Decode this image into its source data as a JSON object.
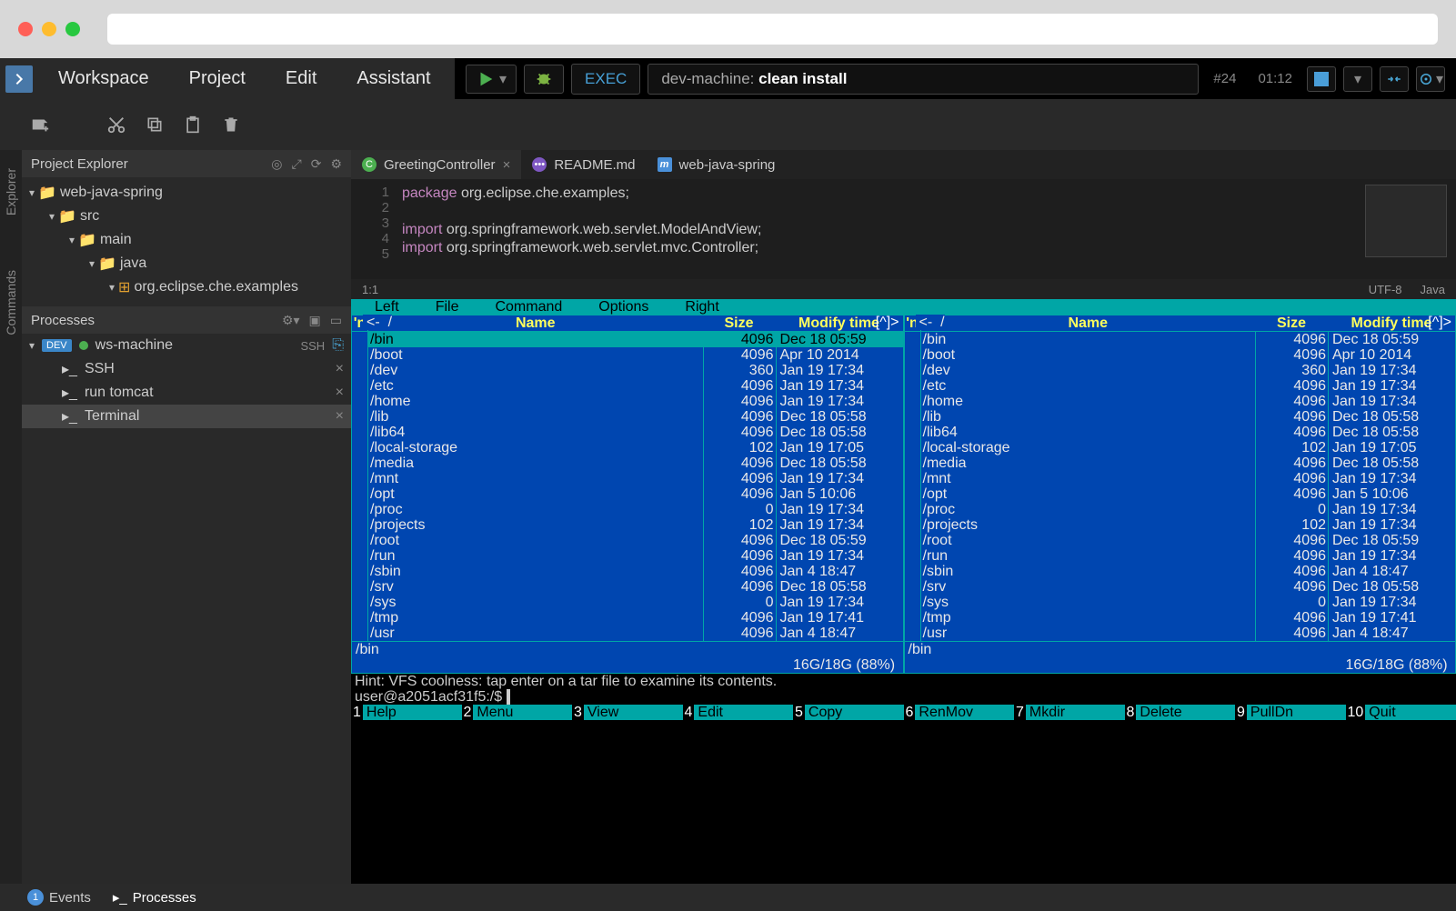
{
  "menu": {
    "workspace": "Workspace",
    "project": "Project",
    "edit": "Edit",
    "assistant": "Assistant"
  },
  "exec": {
    "label": "EXEC",
    "prefix": "dev-machine: ",
    "cmd": "clean install",
    "run_no": "#24",
    "time": "01:12"
  },
  "explorer": {
    "title": "Project Explorer",
    "nodes": {
      "root": "web-java-spring",
      "src": "src",
      "main": "main",
      "java": "java",
      "pkg": "org.eclipse.che.examples"
    }
  },
  "processes": {
    "title": "Processes",
    "machine": "ws-machine",
    "badge": "DEV",
    "ssh_abbr": "SSH",
    "items": [
      "SSH",
      "run tomcat",
      "Terminal"
    ]
  },
  "tabs": [
    {
      "icon": "green",
      "icon_text": "C",
      "label": "GreetingController",
      "closable": true,
      "active": true
    },
    {
      "icon": "purple",
      "icon_text": "•••",
      "label": "README.md",
      "closable": false,
      "active": false
    },
    {
      "icon": "blue",
      "icon_text": "m",
      "label": "web-java-spring",
      "closable": false,
      "active": false
    }
  ],
  "code": {
    "lines": [
      {
        "n": 1,
        "html": "<span class='kw'>package</span> org.eclipse.che.examples;"
      },
      {
        "n": 2,
        "html": ""
      },
      {
        "n": 3,
        "html": "<span class='kw'>import</span> org.springframework.web.servlet.ModelAndView;"
      },
      {
        "n": 4,
        "html": "<span class='kw'>import</span> org.springframework.web.servlet.mvc.Controller;"
      },
      {
        "n": 5,
        "html": ""
      }
    ],
    "cursor": "1:1",
    "encoding": "UTF-8",
    "lang": "Java"
  },
  "mc": {
    "menus": [
      "Left",
      "File",
      "Command",
      "Options",
      "Right"
    ],
    "left_path": "/",
    "right_path": "/",
    "columns": {
      "n": "'n",
      "name": "Name",
      "size": "Size",
      "mtime": "Modify time"
    },
    "rows": [
      {
        "name": "/bin",
        "size": "4096",
        "m": "Dec 18 05:59",
        "cursor": true
      },
      {
        "name": "/boot",
        "size": "4096",
        "m": "Apr 10  2014"
      },
      {
        "name": "/dev",
        "size": "360",
        "m": "Jan 19 17:34"
      },
      {
        "name": "/etc",
        "size": "4096",
        "m": "Jan 19 17:34"
      },
      {
        "name": "/home",
        "size": "4096",
        "m": "Jan 19 17:34"
      },
      {
        "name": "/lib",
        "size": "4096",
        "m": "Dec 18 05:58"
      },
      {
        "name": "/lib64",
        "size": "4096",
        "m": "Dec 18 05:58"
      },
      {
        "name": "/local-storage",
        "size": "102",
        "m": "Jan 19 17:05"
      },
      {
        "name": "/media",
        "size": "4096",
        "m": "Dec 18 05:58"
      },
      {
        "name": "/mnt",
        "size": "4096",
        "m": "Jan 19 17:34"
      },
      {
        "name": "/opt",
        "size": "4096",
        "m": "Jan  5 10:06"
      },
      {
        "name": "/proc",
        "size": "0",
        "m": "Jan 19 17:34"
      },
      {
        "name": "/projects",
        "size": "102",
        "m": "Jan 19 17:34"
      },
      {
        "name": "/root",
        "size": "4096",
        "m": "Dec 18 05:59"
      },
      {
        "name": "/run",
        "size": "4096",
        "m": "Jan 19 17:34"
      },
      {
        "name": "/sbin",
        "size": "4096",
        "m": "Jan  4 18:47"
      },
      {
        "name": "/srv",
        "size": "4096",
        "m": "Dec 18 05:58"
      },
      {
        "name": "/sys",
        "size": "0",
        "m": "Jan 19 17:34"
      },
      {
        "name": "/tmp",
        "size": "4096",
        "m": "Jan 19 17:41"
      },
      {
        "name": "/usr",
        "size": "4096",
        "m": "Jan  4 18:47"
      }
    ],
    "selected": "/bin",
    "disk": "16G/18G (88%)",
    "hint": "Hint: VFS coolness: tap enter on a tar file to examine its contents.",
    "prompt": "user@a2051acf31f5:/$",
    "fkeys": [
      {
        "n": "1",
        "l": "Help"
      },
      {
        "n": "2",
        "l": "Menu"
      },
      {
        "n": "3",
        "l": "View"
      },
      {
        "n": "4",
        "l": "Edit"
      },
      {
        "n": "5",
        "l": "Copy"
      },
      {
        "n": "6",
        "l": "RenMov"
      },
      {
        "n": "7",
        "l": "Mkdir"
      },
      {
        "n": "8",
        "l": "Delete"
      },
      {
        "n": "9",
        "l": "PullDn"
      },
      {
        "n": "10",
        "l": "Quit"
      }
    ]
  },
  "bottom": {
    "events": "Events",
    "events_count": "1",
    "processes": "Processes"
  },
  "rail": {
    "explorer": "Explorer",
    "commands": "Commands"
  }
}
